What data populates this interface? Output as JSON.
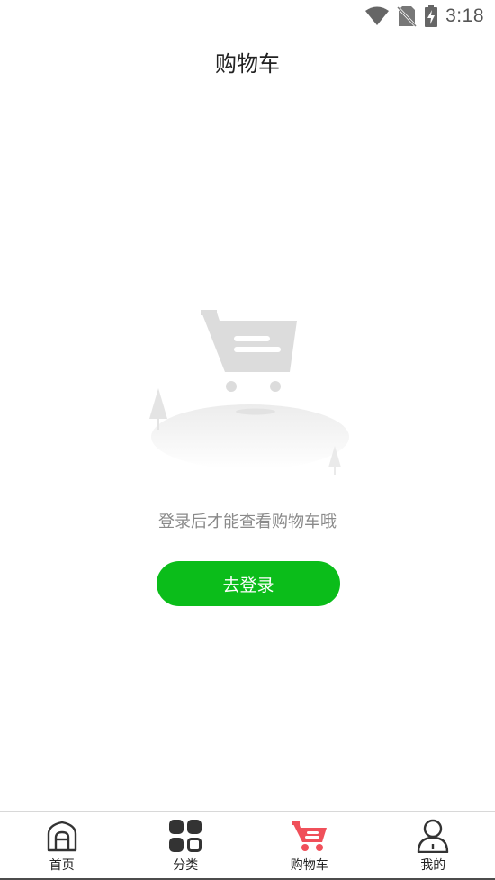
{
  "status_bar": {
    "time": "3:18",
    "icons": [
      "wifi-icon",
      "no-sim-icon",
      "battery-charging-icon"
    ]
  },
  "header": {
    "title": "购物车"
  },
  "empty_state": {
    "illustration": "empty-cart-illustration",
    "message": "登录后才能查看购物车哦",
    "button_label": "去登录"
  },
  "colors": {
    "accent": "#0bbd1a",
    "active_tab": "#f0505a",
    "text_muted": "#8a8a8a",
    "illustration_gray": "#dcdcdc"
  },
  "tabs": [
    {
      "label": "首页",
      "icon": "home-icon",
      "active": false
    },
    {
      "label": "分类",
      "icon": "category-grid-icon",
      "active": false
    },
    {
      "label": "购物车",
      "icon": "shopping-cart-icon",
      "active": true
    },
    {
      "label": "我的",
      "icon": "user-icon",
      "active": false
    }
  ]
}
